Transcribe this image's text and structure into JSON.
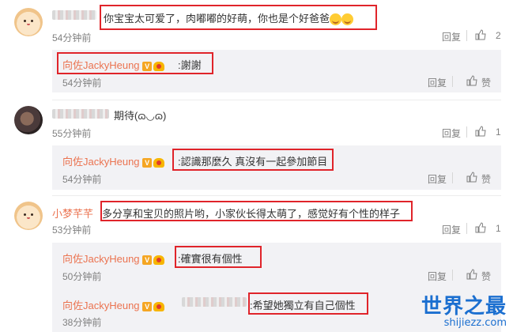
{
  "comments": [
    {
      "text": "你宝宝太可爱了，肉嘟嘟的好萌，你也是个好爸爸",
      "time": "54分钟前",
      "reply_label": "回复",
      "like_count": "2",
      "replies": [
        {
          "name": "向佐JackyHeung",
          "text": "謝謝",
          "time": "54分钟前",
          "reply_label": "回复",
          "like_label": "赞"
        }
      ]
    },
    {
      "text": "期待(ɷ◡ɷ)",
      "time": "55分钟前",
      "reply_label": "回复",
      "like_count": "1",
      "replies": [
        {
          "name": "向佐JackyHeung",
          "text": "認識那麼久 真沒有一起參加節目",
          "time": "54分钟前",
          "reply_label": "回复",
          "like_label": "赞"
        }
      ]
    },
    {
      "name": "小梦芊芊",
      "text": "多分享和宝贝的照片哟，小家伙长得太萌了，感觉好有个性的样子",
      "time": "53分钟前",
      "reply_label": "回复",
      "like_count": "1",
      "replies": [
        {
          "name": "向佐JackyHeung",
          "text": "確實很有個性",
          "time": "50分钟前",
          "reply_label": "回复",
          "like_label": "赞"
        },
        {
          "name": "向佐JackyHeung",
          "text": "希望她獨立有自己個性",
          "time": "38分钟前"
        }
      ]
    }
  ],
  "colors": {
    "highlight": "#e0242a",
    "username": "#eb7350",
    "reply_bg": "#f2f2f5"
  },
  "watermark": {
    "title": "世界之最",
    "url": "shijiezz.com"
  }
}
